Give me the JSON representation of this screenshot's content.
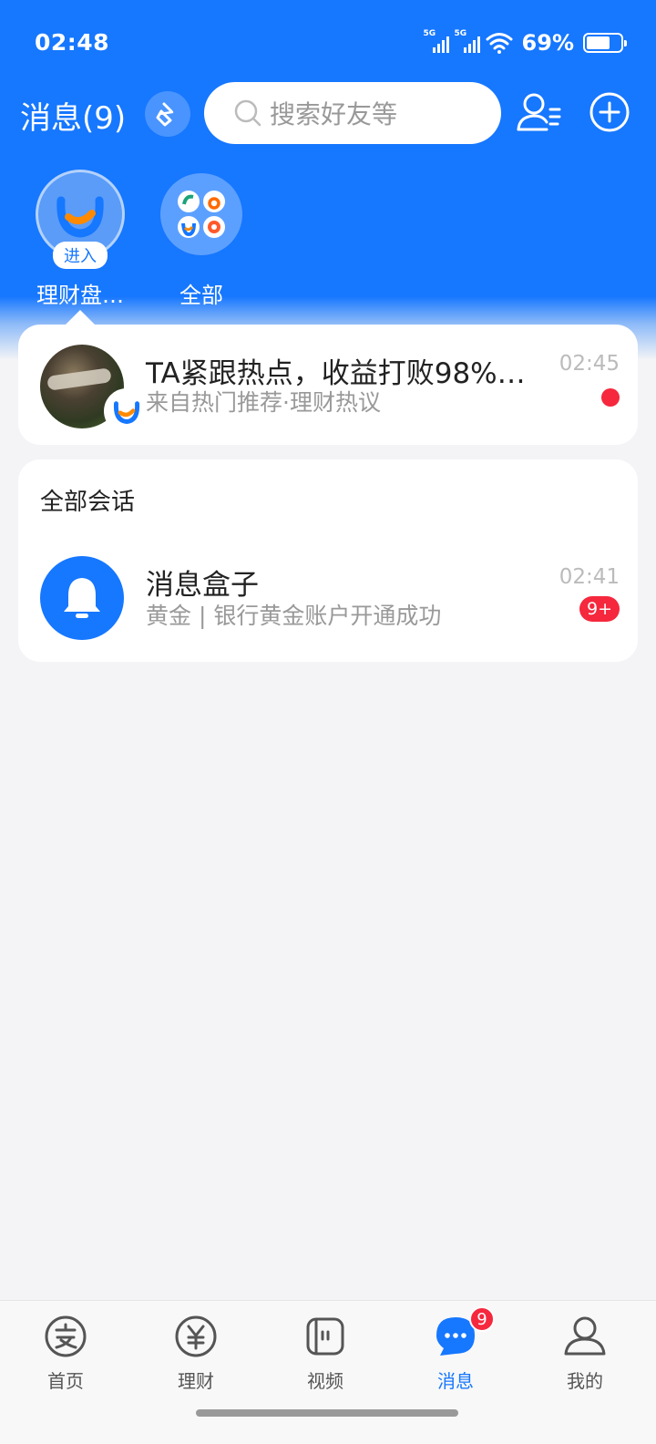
{
  "status_bar": {
    "time": "02:48",
    "network_1": "5G",
    "network_2": "5G",
    "battery_percent": "69%",
    "battery_level": 0.69
  },
  "header": {
    "title": "消息(9)",
    "search_placeholder": "搜索好友等"
  },
  "shortcuts": [
    {
      "label": "理财盘…",
      "badge": "进入",
      "icon": "wealth-smile-logo"
    },
    {
      "label": "全部",
      "icon": "app-grid-icons"
    }
  ],
  "promo_message": {
    "title": "TA紧跟热点，收益打败98%…",
    "subtitle": "来自热门推荐·理财热议",
    "time": "02:45",
    "unread": true
  },
  "conversations": {
    "section_title": "全部会话",
    "items": [
      {
        "title": "消息盒子",
        "subtitle": "黄金 | 银行黄金账户开通成功",
        "time": "02:41",
        "badge": "9+",
        "icon": "bell-icon"
      }
    ]
  },
  "tabbar": {
    "items": [
      {
        "label": "首页",
        "icon": "alipay-icon"
      },
      {
        "label": "理财",
        "icon": "yen-icon"
      },
      {
        "label": "视频",
        "icon": "video-icon"
      },
      {
        "label": "消息",
        "icon": "chat-icon",
        "badge": "9",
        "active": true
      },
      {
        "label": "我的",
        "icon": "user-icon"
      }
    ]
  },
  "colors": {
    "brand_blue": "#1677ff",
    "badge_red": "#f5283d",
    "background": "#f4f4f6"
  }
}
